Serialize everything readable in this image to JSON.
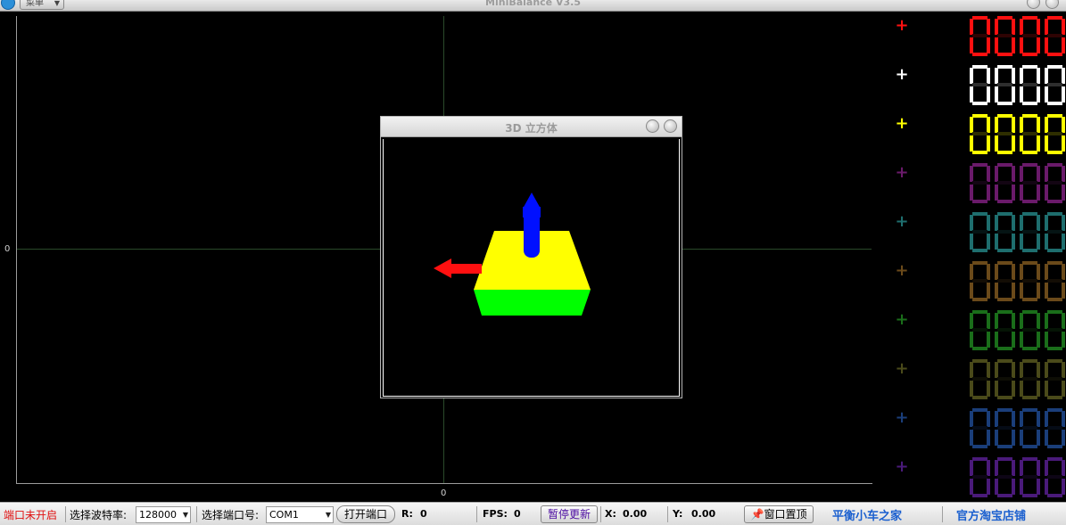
{
  "window": {
    "title": "MiniBalance V3.5",
    "menu_label": "菜单"
  },
  "plot": {
    "y_zero_label": "0",
    "x_zero_label": "0"
  },
  "channels": [
    {
      "color": "#ff1010",
      "value_digits": [
        "0",
        "0",
        "0",
        "0"
      ]
    },
    {
      "color": "#ffffff",
      "value_digits": [
        "0",
        "0",
        "0",
        "0"
      ]
    },
    {
      "color": "#ffff00",
      "value_digits": [
        "0",
        "0",
        "0",
        "0"
      ]
    },
    {
      "color": "#6a1a6a",
      "value_digits": [
        "0",
        "0",
        "0",
        "0"
      ]
    },
    {
      "color": "#1e6e6e",
      "value_digits": [
        "0",
        "0",
        "0",
        "0"
      ]
    },
    {
      "color": "#6b4a1a",
      "value_digits": [
        "0",
        "0",
        "0",
        "0"
      ]
    },
    {
      "color": "#1a6e1a",
      "value_digits": [
        "0",
        "0",
        "0",
        "0"
      ]
    },
    {
      "color": "#4a4a1a",
      "value_digits": [
        "0",
        "0",
        "0",
        "0"
      ]
    },
    {
      "color": "#1a3e7a",
      "value_digits": [
        "0",
        "0",
        "0",
        "0"
      ]
    },
    {
      "color": "#4a1a7a",
      "value_digits": [
        "0",
        "0",
        "0",
        "0"
      ]
    }
  ],
  "dialog": {
    "title": "3D 立方体"
  },
  "statusbar": {
    "port_status": "端口未开启",
    "baud_label": "选择波特率:",
    "baud_value": "128000",
    "port_label": "选择端口号:",
    "port_value": "COM1",
    "open_port_button": "打开端口",
    "r_label": "R:",
    "r_value": "0",
    "fps_label": "FPS:",
    "fps_value": "0",
    "pause_button": "暂停更新",
    "x_label": "X:",
    "x_value": "0.00",
    "y_label": "Y:",
    "y_value": "0.00",
    "pin_button": "窗口置顶",
    "link_home": "平衡小车之家",
    "link_shop": "官方淘宝店铺"
  }
}
